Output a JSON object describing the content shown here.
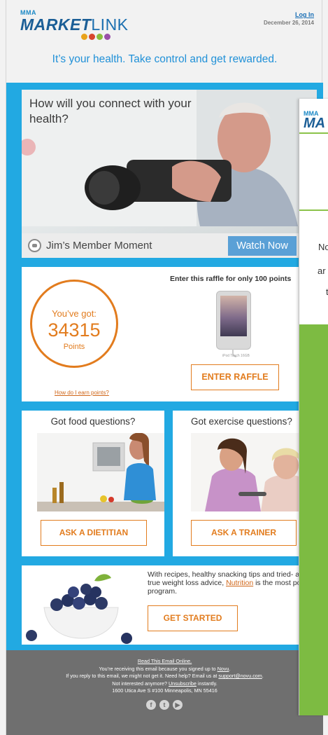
{
  "header": {
    "logo_small": "MMA",
    "logo_market": "MARKET",
    "logo_link": "LINK",
    "login_label": "Log In",
    "date": "December 26, 2014",
    "tagline": "It’s your health. Take control and get rewarded."
  },
  "hero": {
    "title": "How will you connect with your health?",
    "caption": "Jim’s Member Moment",
    "button": "Watch Now"
  },
  "points": {
    "youve_got": "You’ve got:",
    "value": "34315",
    "unit": "Points",
    "earn_link": "How do I earn points?",
    "raffle_title": "Enter this raffle for only 100 points",
    "prize_label": "iPod Touch 16GB",
    "raffle_button": "ENTER RAFFLE"
  },
  "food": {
    "title": "Got food questions?",
    "button": "ASK A DIETITIAN"
  },
  "exercise": {
    "title": "Got exercise questions?",
    "button": "ASK A TRAINER"
  },
  "nutrition": {
    "text_before": "With recipes, healthy snacking tips and tried- and- true weight loss advice, ",
    "link": "Nutrition",
    "text_after": " is the most popular program.",
    "button": "GET STARTED"
  },
  "footer": {
    "read_online": "Read This Email Online.",
    "line2_before": "You’re receiving this email because you signed up to ",
    "line2_link": "Novu",
    "line2_after": ".",
    "line3_before": "If you reply to this email, we might not get it. Need help? Email us at ",
    "line3_link": "support@novu.com",
    "line3_after": ".",
    "line4_before": "Not interested anymore? ",
    "line4_link": "Unsubscribe",
    "line4_after": " instantly.",
    "address": "1600 Utica Ave S #100 Minneapolis, MN 55416",
    "social": [
      "f",
      "t",
      "▶"
    ]
  },
  "overlay": {
    "logo_small": "MMA",
    "logo_big": "MA",
    "text1": "No",
    "text2": "ar",
    "text3": "t"
  },
  "colors": {
    "blue_panel": "#22a9e2",
    "orange": "#e27c1e",
    "footer": "#6f6f6f",
    "brand_blue": "#1b5e96",
    "green": "#7dbb42"
  }
}
